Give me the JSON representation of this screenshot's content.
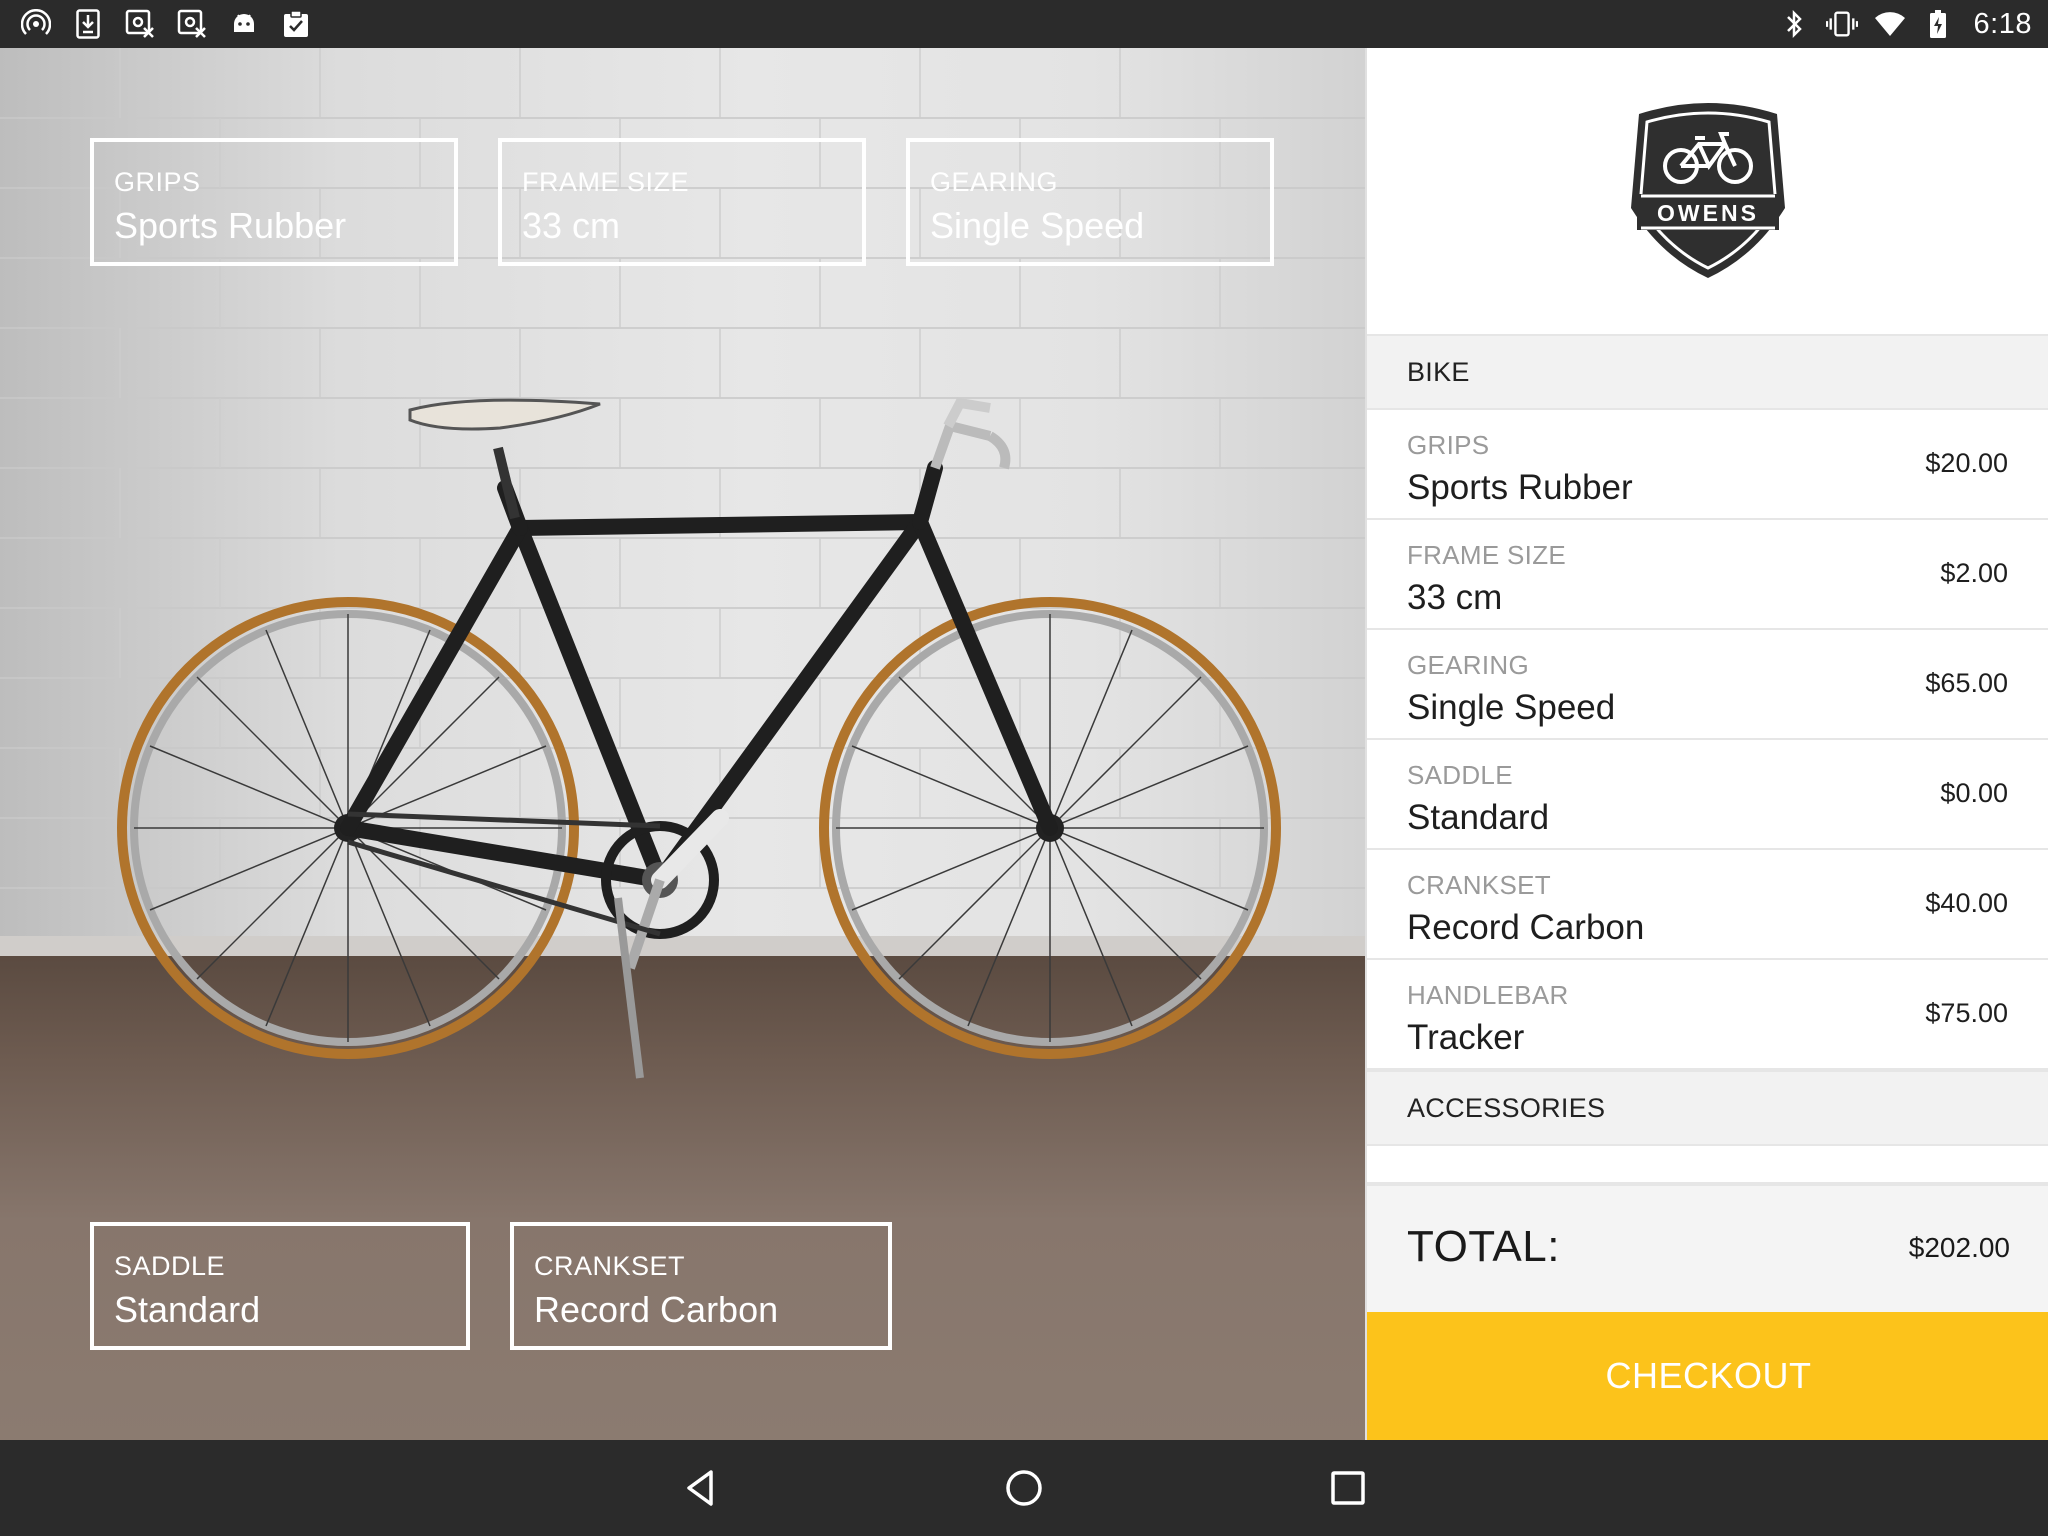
{
  "status_bar": {
    "time": "6:18",
    "left_icons": [
      "hotspot-icon",
      "download-icon",
      "image-remove-icon",
      "image-remove-icon",
      "android-icon",
      "clipboard-check-icon"
    ],
    "right_icons": [
      "bluetooth-icon",
      "vibrate-icon",
      "wifi-icon",
      "battery-charging-icon"
    ]
  },
  "overlay_specs": [
    {
      "key": "GRIPS",
      "value": "Sports Rubber"
    },
    {
      "key": "FRAME SIZE",
      "value": "33 cm"
    },
    {
      "key": "GEARING",
      "value": "Single Speed"
    },
    {
      "key": "SADDLE",
      "value": "Standard"
    },
    {
      "key": "CRANKSET",
      "value": "Record Carbon"
    }
  ],
  "brand": {
    "name": "OWENS"
  },
  "cart": {
    "bike_header": "BIKE",
    "items": [
      {
        "key": "GRIPS",
        "value": "Sports Rubber",
        "price": "$20.00"
      },
      {
        "key": "FRAME SIZE",
        "value": "33 cm",
        "price": "$2.00"
      },
      {
        "key": "GEARING",
        "value": "Single Speed",
        "price": "$65.00"
      },
      {
        "key": "SADDLE",
        "value": "Standard",
        "price": "$0.00"
      },
      {
        "key": "CRANKSET",
        "value": "Record Carbon",
        "price": "$40.00"
      },
      {
        "key": "HANDLEBAR",
        "value": "Tracker",
        "price": "$75.00"
      }
    ],
    "accessories_header": "ACCESSORIES",
    "total_label": "TOTAL:",
    "total_value": "$202.00",
    "checkout_label": "CHECKOUT"
  },
  "colors": {
    "accent": "#fcc31b",
    "bars": "#2b2b2b"
  },
  "nav": {
    "icons": [
      "back-icon",
      "home-icon",
      "recents-icon"
    ]
  }
}
